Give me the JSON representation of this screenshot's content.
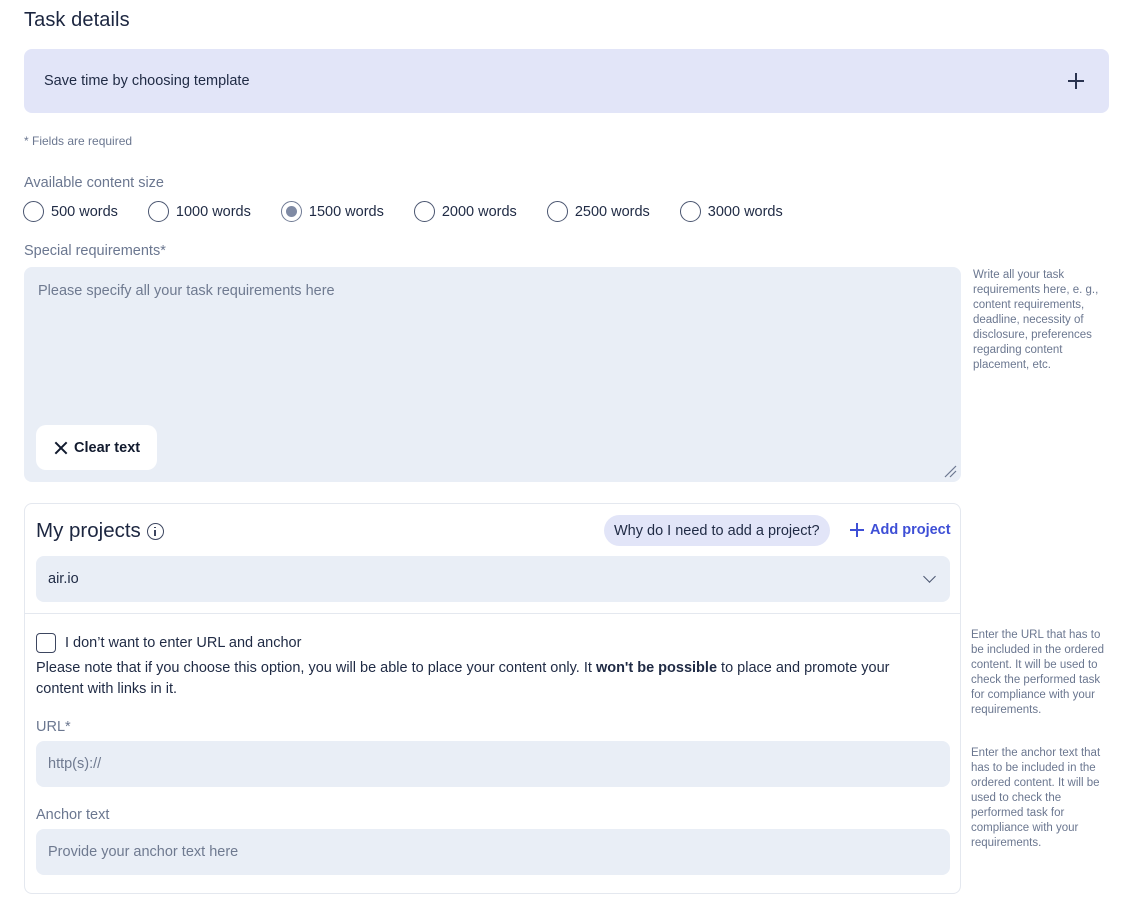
{
  "page": {
    "title": "Task details"
  },
  "template": {
    "label": "Save time by choosing template"
  },
  "required_note": "* Fields are required",
  "content_size": {
    "label": "Available content size",
    "options": [
      "500 words",
      "1000 words",
      "1500 words",
      "2000 words",
      "2500 words",
      "3000 words"
    ],
    "selected": "1500 words"
  },
  "special_requirements": {
    "label": "Special requirements*",
    "placeholder": "Please specify all your task requirements here",
    "value": "",
    "clear_label": "Clear text",
    "hint": "Write all your task requirements here, e. g., content requirements, deadline, necessity of disclosure, preferences regarding content placement, etc."
  },
  "projects": {
    "title": "My projects",
    "why_label": "Why do I need to add a project?",
    "add_label": "Add project",
    "selected": "air.io",
    "no_url_label": "I don’t want to enter URL and anchor",
    "no_url_checked": false,
    "note_before": "Please note that if you choose this option, you will be able to place your content only. It ",
    "note_bold": "won't be possible",
    "note_after": " to place and promote your content with links in it.",
    "url_label": "URL*",
    "url_placeholder": "http(s)://",
    "url_hint": "Enter the URL that has to be included in the ordered content. It will be used to check the performed task for compliance with your requirements.",
    "anchor_label": "Anchor text",
    "anchor_placeholder": "Provide your anchor text here",
    "anchor_hint": "Enter the anchor text that has to be included in the ordered content. It will be used to check the performed task for compliance with your requirements."
  },
  "colors": {
    "accent": "#3e4fd6",
    "template_bg": "#e2e5f8",
    "field_bg": "#e9eef6"
  }
}
